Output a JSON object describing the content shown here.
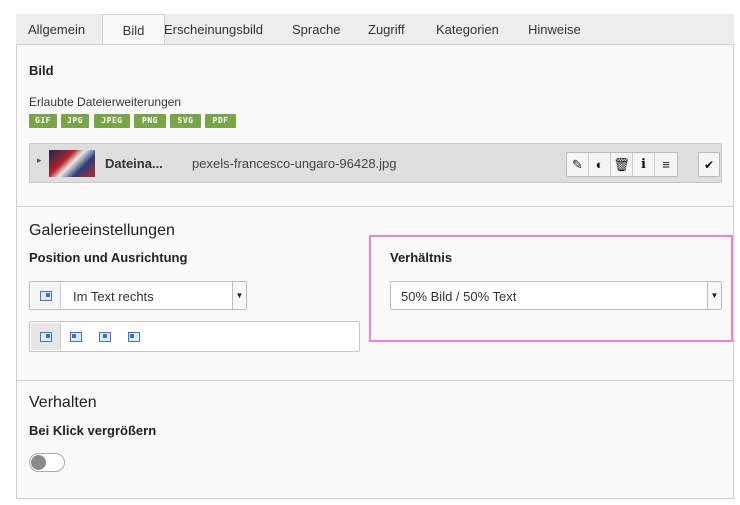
{
  "tabs": [
    {
      "label": "Allgemein"
    },
    {
      "label": "Bild"
    },
    {
      "label": "Erscheinungsbild"
    },
    {
      "label": "Sprache"
    },
    {
      "label": "Zugriff"
    },
    {
      "label": "Kategorien"
    },
    {
      "label": "Hinweise"
    }
  ],
  "active_tab": "Bild",
  "image_section": {
    "title": "Bild",
    "allowed_label": "Erlaubte Dateierweiterungen",
    "extensions": [
      "GIF",
      "JPG",
      "JPEG",
      "PNG",
      "SVG",
      "PDF"
    ],
    "file": {
      "label": "Dateina...",
      "name": "pexels-francesco-ungaro-96428.jpg",
      "actions": [
        {
          "icon": "pencil-icon",
          "glyph": "✎"
        },
        {
          "icon": "toggle-visibility-icon",
          "glyph": "◐"
        },
        {
          "icon": "trash-icon",
          "glyph": "🗑"
        },
        {
          "icon": "info-icon",
          "glyph": "i"
        },
        {
          "icon": "menu-icon",
          "glyph": "≡"
        }
      ],
      "select_glyph": "✔"
    }
  },
  "gallery": {
    "title": "Galerieeinstellungen",
    "position_label": "Position und Ausrichtung",
    "position_value": "Im Text rechts",
    "ratio_label": "Verhältnis",
    "ratio_value": "50% Bild / 50% Text"
  },
  "behaviour": {
    "title": "Verhalten",
    "click_label": "Bei Klick vergrößern",
    "click_enlarge": false
  },
  "colors": {
    "badge": "#79a548",
    "highlight": "#ee7ee0",
    "accent_icon": "#3b6fc0"
  }
}
